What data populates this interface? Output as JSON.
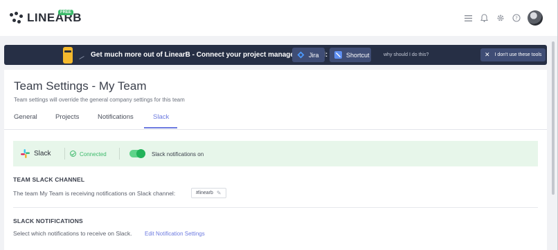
{
  "header": {
    "brand": "LINEARB",
    "plan_badge": "FREE",
    "icons": [
      "menu-icon",
      "bell-icon",
      "gear-icon",
      "help-icon"
    ]
  },
  "banner": {
    "message": "Get much more out of LinearB - Connect your project management tool:",
    "jira_label": "Jira",
    "shortcut_label": "Shortcut",
    "why_link": "why should I do this?",
    "dismiss_label": "I don't use these tools",
    "colors": {
      "background": "#262f45",
      "button": "#3f4d75"
    }
  },
  "page": {
    "title": "Team Settings - My Team",
    "subtitle": "Team settings will override the general company settings for this team"
  },
  "tabs": [
    {
      "label": "General",
      "active": false
    },
    {
      "label": "Projects",
      "active": false
    },
    {
      "label": "Notifications",
      "active": false
    },
    {
      "label": "Slack",
      "active": true
    }
  ],
  "slack_status": {
    "name": "Slack",
    "connection_status": "Connected",
    "toggle_on": true,
    "toggle_label": "Slack notifications on",
    "colors": {
      "background": "#e7f6ea",
      "accent": "#3bb96a"
    }
  },
  "team_channel": {
    "heading": "TEAM SLACK CHANNEL",
    "description": "The team My Team is receiving notifications on Slack channel:",
    "channel": "#linearb"
  },
  "slack_notifications": {
    "heading": "SLACK NOTIFICATIONS",
    "description": "Select which notifications to receive on Slack.",
    "edit_link": "Edit Notification Settings"
  },
  "theme": {
    "accent": "#6c7ae0"
  }
}
